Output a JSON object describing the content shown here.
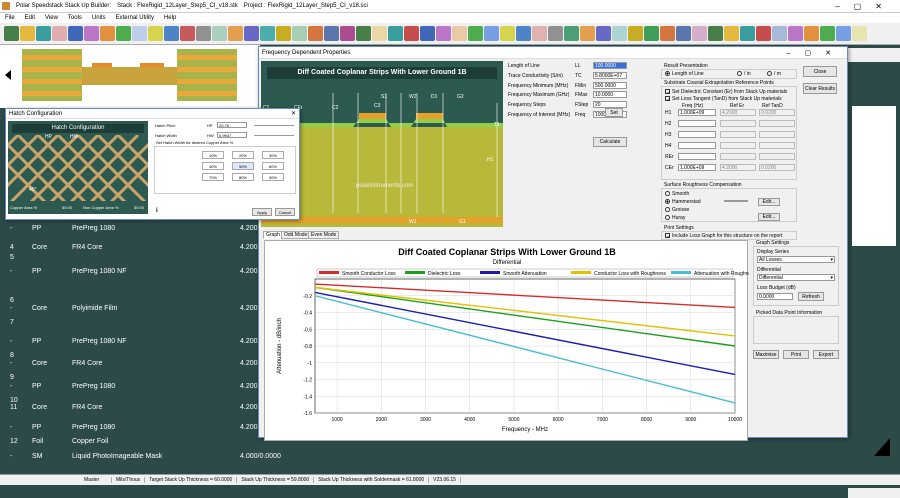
{
  "app": {
    "title": "Polar Speedstack Stack Up Builder:",
    "stack": "Stack : FlexRigid_12Layer_Step5_CI_v18.stk",
    "project": "Project : FlexRigid_12Layer_Step5_CI_v18.sci"
  },
  "menu": [
    "File",
    "Edit",
    "View",
    "Tools",
    "Units",
    "External Utility",
    "Help"
  ],
  "stack_rows": [
    {
      "num": "-",
      "type": "PP",
      "mat": "PrePreg 1080",
      "th": "4.200",
      "y": 225
    },
    {
      "num": "4",
      "type": "Core",
      "mat": "FR4 Core",
      "th": "4.200",
      "y": 244
    },
    {
      "num": "5",
      "type": "",
      "mat": "",
      "th": "",
      "y": 254
    },
    {
      "num": "-",
      "type": "PP",
      "mat": "PrePreg 1080 NF",
      "th": "4.200",
      "y": 268
    },
    {
      "num": "6",
      "type": "",
      "mat": "",
      "th": "",
      "y": 297
    },
    {
      "num": "-",
      "type": "Core",
      "mat": "Polyimide Film",
      "th": "4.200",
      "y": 305
    },
    {
      "num": "7",
      "type": "",
      "mat": "",
      "th": "",
      "y": 319
    },
    {
      "num": "-",
      "type": "PP",
      "mat": "PrePreg 1080 NF",
      "th": "4.200",
      "y": 338
    },
    {
      "num": "8",
      "type": "",
      "mat": "",
      "th": "",
      "y": 352
    },
    {
      "num": "-",
      "type": "Core",
      "mat": "FR4 Core",
      "th": "4.200",
      "y": 360
    },
    {
      "num": "9",
      "type": "",
      "mat": "",
      "th": "",
      "y": 374
    },
    {
      "num": "-",
      "type": "PP",
      "mat": "PrePreg 1080",
      "th": "4.200",
      "y": 383
    },
    {
      "num": "10",
      "type": "",
      "mat": "",
      "th": "",
      "y": 397
    },
    {
      "num": "11",
      "type": "Core",
      "mat": "FR4 Core",
      "th": "4.200",
      "y": 404
    },
    {
      "num": "-",
      "type": "PP",
      "mat": "PrePreg 1080",
      "th": "4.200",
      "y": 424
    },
    {
      "num": "12",
      "type": "Foil",
      "mat": "Copper Foil",
      "th": "",
      "y": 438
    },
    {
      "num": "-",
      "type": "SM",
      "mat": "Liquid PhotoImageable Mask",
      "th": "4.000/0.0000",
      "y": 453
    }
  ],
  "status": [
    "Master",
    "Mils/Thous",
    "Target Stack Up Thickness = 60.0000",
    "Stack Up Thickness = 59.8000",
    "Stack Up Thickness with Soldermask = 61.8000",
    "V23.06.15"
  ],
  "fdp": {
    "title": "Frequency Dependent Properties",
    "diagram_title": "Diff Coated Coplanar Strips With Lower Ground 1B",
    "diag_labels": [
      "C1",
      "CEr",
      "C2",
      "C3",
      "S1",
      "W2",
      "D1",
      "G2",
      "T1",
      "H1",
      "W1",
      "G1"
    ],
    "watermark": "polarinstruments.com",
    "params": [
      {
        "label": "Length of Line",
        "sym": "LL",
        "val": "100.0000"
      },
      {
        "label": "Trace Conductivity (S/m)",
        "sym": "TC",
        "val": "5.8000E+07"
      },
      {
        "label": "Frequency Minimum (MHz)",
        "sym": "FMin",
        "val": "500.0000"
      },
      {
        "label": "Frequency Maximum (GHz)",
        "sym": "FMax",
        "val": "10.0000"
      },
      {
        "label": "Frequency Steps",
        "sym": "FStep",
        "val": "20"
      },
      {
        "label": "Frequency of Interest (MHz)",
        "sym": "Freq",
        "val": "1000.0000"
      }
    ],
    "set_btn": "Set",
    "calc_btn": "Calculate",
    "result_title": "Result Presentation",
    "result_opts": [
      "Length of Line",
      "/ in",
      "/ m"
    ],
    "close_btn": "Close",
    "clear_btn": "Clear Results",
    "sub_title": "Substrate Coaxial Extrapolation Reference Points",
    "sub_cb": [
      "Set Dielectric Constant (Er) from Stack Up materials",
      "Set Loss Tangent (TanD) from Stack Up materials"
    ],
    "sub_cols": [
      "Freq (Hz)",
      "Ref Er",
      "Ref TanD"
    ],
    "sub_rows": [
      {
        "name": "H1",
        "f": "1.000E+09",
        "er": "4.2000",
        "td": "0.0200"
      },
      {
        "name": "H2",
        "f": "",
        "er": "",
        "td": ""
      },
      {
        "name": "H3",
        "f": "",
        "er": "",
        "td": ""
      },
      {
        "name": "H4",
        "f": "",
        "er": "",
        "td": ""
      },
      {
        "name": "REr",
        "f": "",
        "er": "",
        "td": ""
      },
      {
        "name": "CEr",
        "f": "1.000E+09",
        "er": "4.2000",
        "td": "0.0200"
      }
    ],
    "rough_title": "Surface Roughness Compensation",
    "rough_opts": [
      "Smooth",
      "Hammerstad",
      "Groisse",
      "Huray"
    ],
    "edit_btn": "Edit...",
    "print_title": "Print Settings",
    "print_cb": "Include Loss Graph for this structure on the report",
    "tabs": [
      "Graph",
      "Odd Mode",
      "Even Mode"
    ],
    "gs_title": "Graph Settings",
    "gs_display": "Display Series",
    "gs_display_val": "All Losses",
    "gs_diff": "Differential",
    "gs_diff_val": "Differential",
    "gs_budget": "Loss Budget (dB)",
    "gs_budget_val": "0.0000",
    "refresh_btn": "Refresh",
    "picked_title": "Picked Data Point Information",
    "maximise_btn": "Maximise",
    "print_btn": "Print",
    "export_btn": "Export"
  },
  "hatch": {
    "title": "Hatch Configuration",
    "heading": "Hatch Configuration",
    "pitch_lbl": "Hatch Pitch",
    "pitch_sym": "HP",
    "pitch_val": "20.76",
    "width_lbl": "Hatch Width",
    "width_sym": "HW",
    "width_val": "0.9947",
    "pct_title": "Set Hatch Width for desired Copper Area %",
    "pcts": [
      "10%",
      "20%",
      "30%",
      "40%",
      "50%",
      "60%",
      "70%",
      "80%",
      "90%"
    ],
    "copper": "Copper Area %",
    "copper_val": "50.00",
    "noncopper": "Non Copper Area %",
    "noncopper_val": "50.00",
    "apply_btn": "Apply",
    "cancel_btn": "Cancel",
    "diag_labels": [
      "HP",
      "HW",
      "45°"
    ]
  },
  "colors": {
    "smooth": "#d52b2b",
    "diel": "#1ba01b",
    "satt": "#1c1cb0",
    "croug": "#e0c200",
    "aroug": "#4bbdd0"
  },
  "chart_data": {
    "type": "line",
    "title": "Diff Coated Coplanar Strips With Lower Ground 1B",
    "subtitle": "Differential",
    "xlabel": "Frequency - MHz",
    "ylabel": "Attenuation - dB/inch",
    "xlim": [
      500,
      10000
    ],
    "ylim": [
      -1.6,
      0
    ],
    "xticks": [
      1000,
      2000,
      3000,
      4000,
      5000,
      6000,
      7000,
      8000,
      9000,
      10000
    ],
    "yticks": [
      -0.2,
      -0.4,
      -0.6,
      -0.8,
      -1,
      -1.2,
      -1.4,
      -1.6
    ],
    "legend_position": "top",
    "x": [
      500,
      10000
    ],
    "series": [
      {
        "name": "Smooth Conductor Loss",
        "values": [
          -0.06,
          -0.34
        ]
      },
      {
        "name": "Dielectric Loss",
        "values": [
          -0.1,
          -0.8
        ]
      },
      {
        "name": "Smooth Attenuation",
        "values": [
          -0.16,
          -1.14
        ]
      },
      {
        "name": "Conductor Loss with Roughness",
        "values": [
          -0.1,
          -0.68
        ]
      },
      {
        "name": "Attenuation with Roughness",
        "values": [
          -0.2,
          -1.48
        ]
      }
    ]
  }
}
